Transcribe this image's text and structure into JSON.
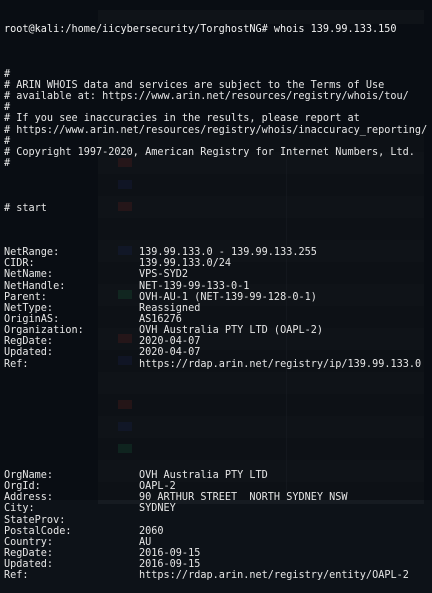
{
  "terminal": {
    "prompt": "root@kali:/home/iicybersecurity/TorghostNG# whois 139.99.133.150",
    "header_lines": [
      "",
      "#",
      "# ARIN WHOIS data and services are subject to the Terms of Use",
      "# available at: https://www.arin.net/resources/registry/whois/tou/",
      "#",
      "# If you see inaccuracies in the results, please report at",
      "# https://www.arin.net/resources/registry/whois/inaccuracy_reporting/",
      "#",
      "# Copyright 1997-2020, American Registry for Internet Numbers, Ltd.",
      "#",
      "",
      "",
      "",
      "# start",
      ""
    ],
    "net_fields": [
      {
        "key": "NetRange:",
        "value": "139.99.133.0 - 139.99.133.255"
      },
      {
        "key": "CIDR:",
        "value": "139.99.133.0/24"
      },
      {
        "key": "NetName:",
        "value": "VPS-SYD2"
      },
      {
        "key": "NetHandle:",
        "value": "NET-139-99-133-0-1"
      },
      {
        "key": "Parent:",
        "value": "OVH-AU-1 (NET-139-99-128-0-1)"
      },
      {
        "key": "NetType:",
        "value": "Reassigned"
      },
      {
        "key": "OriginAS:",
        "value": "AS16276"
      },
      {
        "key": "Organization:",
        "value": "OVH Australia PTY LTD (OAPL-2)"
      },
      {
        "key": "RegDate:",
        "value": "2020-04-07"
      },
      {
        "key": "Updated:",
        "value": "2020-04-07"
      },
      {
        "key": "Ref:",
        "value": "https://rdap.arin.net/registry/ip/139.99.133.0"
      }
    ],
    "gap_lines": [
      "",
      "",
      "",
      "",
      ""
    ],
    "org_fields": [
      {
        "key": "OrgName:",
        "value": "OVH Australia PTY LTD"
      },
      {
        "key": "OrgId:",
        "value": "OAPL-2"
      },
      {
        "key": "Address:",
        "value": "90 ARTHUR STREET  NORTH SYDNEY NSW"
      },
      {
        "key": "City:",
        "value": "SYDNEY"
      },
      {
        "key": "StateProv:",
        "value": ""
      },
      {
        "key": "PostalCode:",
        "value": "2060"
      },
      {
        "key": "Country:",
        "value": "AU"
      },
      {
        "key": "RegDate:",
        "value": "2016-09-15"
      },
      {
        "key": "Updated:",
        "value": "2016-09-15"
      },
      {
        "key": "Ref:",
        "value": "https://rdap.arin.net/registry/entity/OAPL-2"
      }
    ]
  },
  "colors": {
    "terminal_bg": "#080c10",
    "text": "#e6e6e6"
  }
}
